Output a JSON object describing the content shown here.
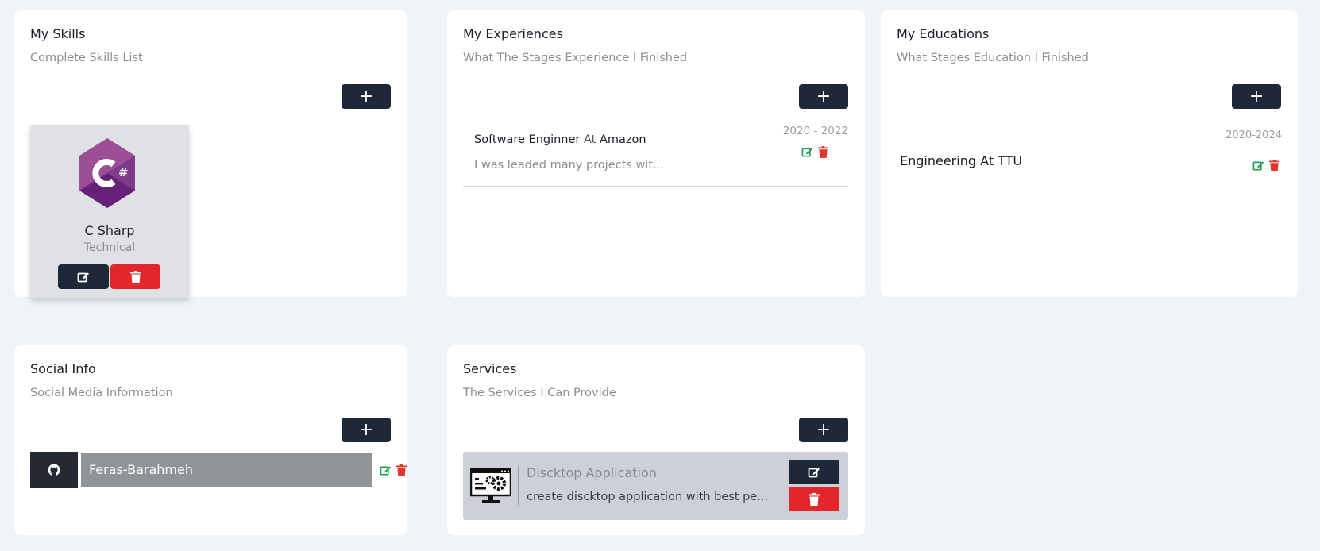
{
  "skills": {
    "title": "My Skills",
    "subtitle": "Complete Skills List",
    "add_label": "+",
    "items": [
      {
        "name": "C Sharp",
        "type": "Technical",
        "logo": "csharp-logo"
      }
    ]
  },
  "experiences": {
    "title": "My Experiences",
    "subtitle": "What The Stages Experience I Finished",
    "add_label": "+",
    "items": [
      {
        "position": "Software Enginner",
        "at": "At",
        "company": "Amazon",
        "description": "I was leaded many projects wit...",
        "years": "2020 - 2022"
      }
    ]
  },
  "educations": {
    "title": "My Educations",
    "subtitle": "What Stages Education I Finished",
    "add_label": "+",
    "items": [
      {
        "title": "Engineering At TTU",
        "years": "2020-2024"
      }
    ]
  },
  "social": {
    "title": "Social Info",
    "subtitle": "Social Media Information",
    "add_label": "+",
    "items": [
      {
        "platform_icon": "github-icon",
        "username": "Feras-Barahmeh"
      }
    ]
  },
  "services": {
    "title": "Services",
    "subtitle": "The Services I Can Provide",
    "add_label": "+",
    "items": [
      {
        "icon": "desktop-app-icon",
        "title": "Discktop Application",
        "description": "create discktop application with best pe..."
      }
    ]
  },
  "colors": {
    "background": "#f0f3f8",
    "dark_button": "#1f2838",
    "danger_button": "#e3262b",
    "edit_green": "#1f9d55",
    "delete_red": "#e3342f"
  }
}
